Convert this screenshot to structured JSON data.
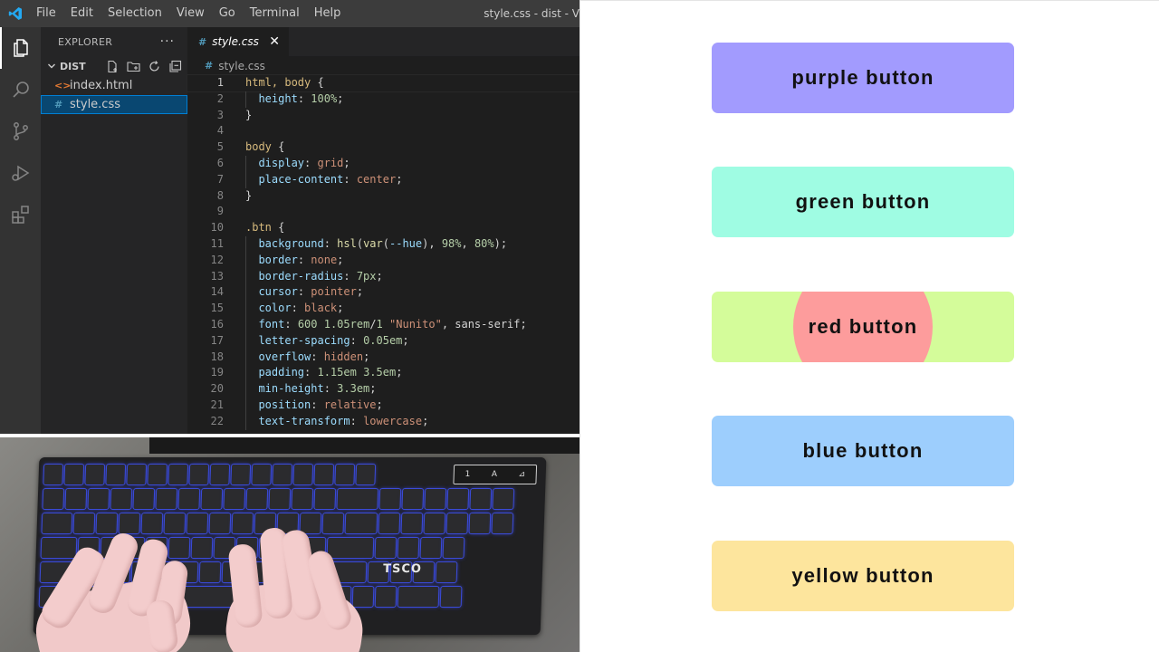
{
  "titlebar": {
    "menu": [
      "File",
      "Edit",
      "Selection",
      "View",
      "Go",
      "Terminal",
      "Help"
    ],
    "window_title": "style.css - dist - V"
  },
  "activitybar": {
    "icons": [
      "explorer-icon",
      "search-icon",
      "source-control-icon",
      "run-debug-icon",
      "extensions-icon"
    ]
  },
  "sidebar": {
    "title": "EXPLORER",
    "more": "···",
    "folder": "DIST",
    "files": [
      {
        "name": "index.html",
        "icon": "<>",
        "type": "html"
      },
      {
        "name": "style.css",
        "icon": "#",
        "type": "css",
        "selected": true
      }
    ]
  },
  "editor": {
    "tab": {
      "label": "style.css",
      "icon": "#",
      "close": "✕"
    },
    "breadcrumb": {
      "label": "style.css",
      "icon": "#"
    },
    "lines": [
      "html, body {",
      "  height: 100%;",
      "}",
      "",
      "body {",
      "  display: grid;",
      "  place-content: center;",
      "}",
      "",
      ".btn {",
      "  background: hsl(var(--hue), 98%, 80%);",
      "  border: none;",
      "  border-radius: 7px;",
      "  cursor: pointer;",
      "  color: black;",
      "  font: 600 1.05rem/1 \"Nunito\", sans-serif;",
      "  letter-spacing: 0.05em;",
      "  overflow: hidden;",
      "  padding: 1.15em 3.5em;",
      "  min-height: 3.3em;",
      "  position: relative;",
      "  text-transform: lowercase;"
    ]
  },
  "keyboard": {
    "brand": "TSCO",
    "media_keys": [
      "1",
      "A",
      "⊿"
    ]
  },
  "preview": {
    "buttons": [
      {
        "label": "purple button",
        "color": "#a29bfe"
      },
      {
        "label": "green button",
        "color": "#9ffce3"
      },
      {
        "label": "red button",
        "color": "#d4fc9a",
        "overlay_color": "#fd9c9c"
      },
      {
        "label": "blue button",
        "color": "#9dcefd"
      },
      {
        "label": "yellow button",
        "color": "#fde59d"
      }
    ]
  }
}
